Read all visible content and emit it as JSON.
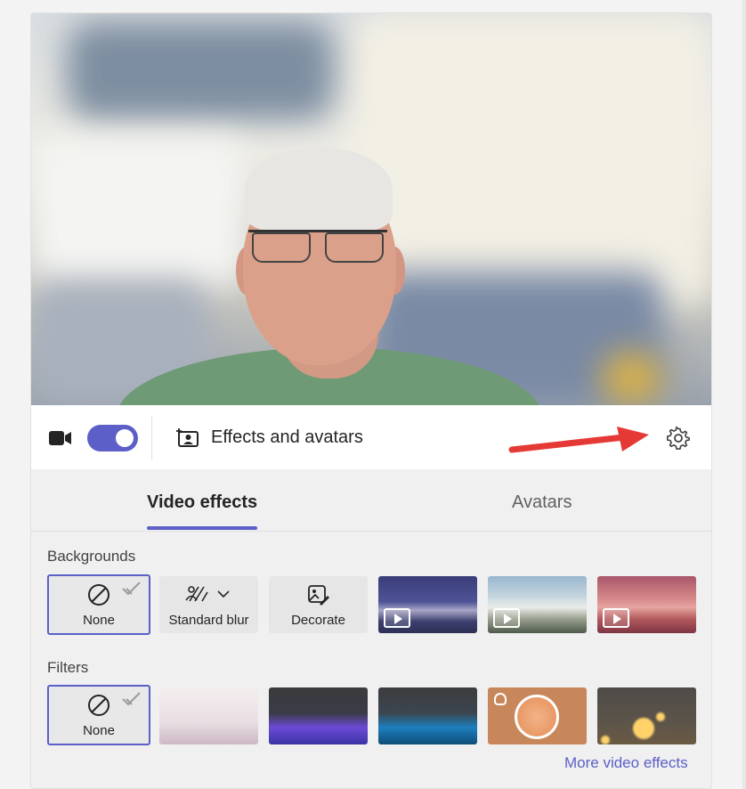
{
  "window": {
    "title": ""
  },
  "controls": {
    "camera_toggle_on": true,
    "effects_label": "Effects and avatars"
  },
  "tabs": [
    {
      "label": "Video effects",
      "selected": true
    },
    {
      "label": "Avatars",
      "selected": false
    }
  ],
  "backgrounds": {
    "label": "Backgrounds",
    "items": [
      {
        "label": "None",
        "icon": "no-entry-icon",
        "selected": true
      },
      {
        "label": "Standard blur",
        "icon": "blur-icon",
        "selected": false
      },
      {
        "label": "Decorate",
        "icon": "decorate-icon",
        "selected": false
      },
      {
        "label": "",
        "icon": "video-background-icon",
        "selected": false
      },
      {
        "label": "",
        "icon": "video-background-icon",
        "selected": false
      },
      {
        "label": "",
        "icon": "video-background-icon",
        "selected": false
      }
    ]
  },
  "filters": {
    "label": "Filters",
    "items": [
      {
        "label": "None",
        "icon": "no-entry-icon",
        "selected": true
      },
      {
        "label": "",
        "selected": false
      },
      {
        "label": "",
        "selected": false
      },
      {
        "label": "",
        "selected": false
      },
      {
        "label": "",
        "icon": "snapchat-ghost-icon",
        "selected": false
      },
      {
        "label": "",
        "selected": false
      }
    ]
  },
  "more_link": "More video effects",
  "colors": {
    "accent": "#5b5fc7",
    "annotation_arrow": "#e53935"
  }
}
